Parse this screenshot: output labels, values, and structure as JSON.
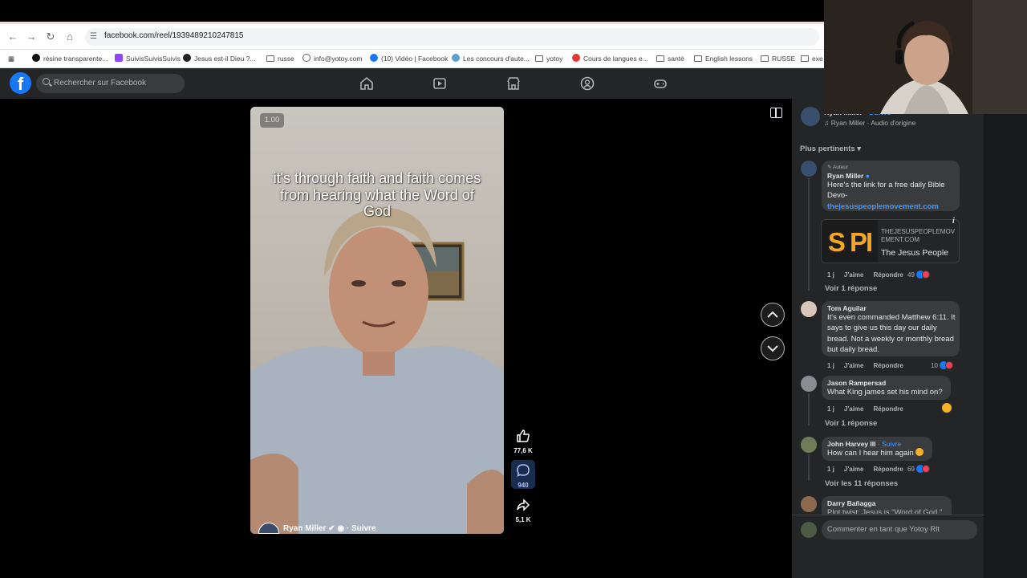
{
  "browser": {
    "url": "facebook.com/reel/1939489210247815",
    "bookmarks": [
      "résine transparente...",
      "SuivisSuivisSuivis",
      "Jesus est-il Dieu ?...",
      "russe",
      "info@yotoy.com",
      "(10) Vidéo | Facebook",
      "Les concours d'aute...",
      "yotoy",
      "Cours de langues e...",
      "santé",
      "English lessons",
      "RUSSE",
      "exe"
    ]
  },
  "facebook": {
    "search_placeholder": "Rechercher sur Facebook"
  },
  "reel": {
    "speed": "1.00",
    "caption": "it's through faith and faith comes from hearing what the Word of God",
    "author": "Ryan Miller",
    "follow": "Suivre",
    "likes": "77,6 K",
    "comments": "940",
    "shares": "5,1 K"
  },
  "panel": {
    "header_author": "Ryan Miller",
    "header_follow": "Suivre",
    "audio": "Ryan Miller · Audio d'origine",
    "sort": "Plus pertinents",
    "comments": [
      {
        "badge": "Auteur",
        "name": "Ryan Miller",
        "text": "Here's the link for a free daily Bible Devo-",
        "link": "thejesuspeoplemovement.com",
        "preview_domain": "THEJESUSPEOPLEMOVEMENT.COM",
        "preview_title": "The Jesus People",
        "preview_logo": "S PI",
        "time": "1 j",
        "like": "J'aime",
        "reply": "Répondre",
        "reactions": "49",
        "replies": "Voir 1 réponse"
      },
      {
        "name": "Tom Aguilar",
        "text": "It's even commanded Matthew 6:11. It says to give us this day our daily bread. Not a weekly or monthly bread but daily bread.",
        "time": "1 j",
        "like": "J'aime",
        "reply": "Répondre",
        "reactions": "10"
      },
      {
        "name": "Jason Rampersad",
        "text": "What King james set his mind on?",
        "time": "1 j",
        "like": "J'aime",
        "reply": "Répondre",
        "replies": "Voir 1 réponse"
      },
      {
        "name": "John Harvey III",
        "follow": "Suivre",
        "text": "How can I hear him again",
        "time": "1 j",
        "like": "J'aime",
        "reply": "Répondre",
        "reactions": "69",
        "replies": "Voir les 11 réponses"
      },
      {
        "name": "Darry Bañagga",
        "text": "Plot twist: Jesus is \"Word of God.\""
      }
    ],
    "composer_placeholder": "Commenter en tant que Yotoy Rlt"
  }
}
